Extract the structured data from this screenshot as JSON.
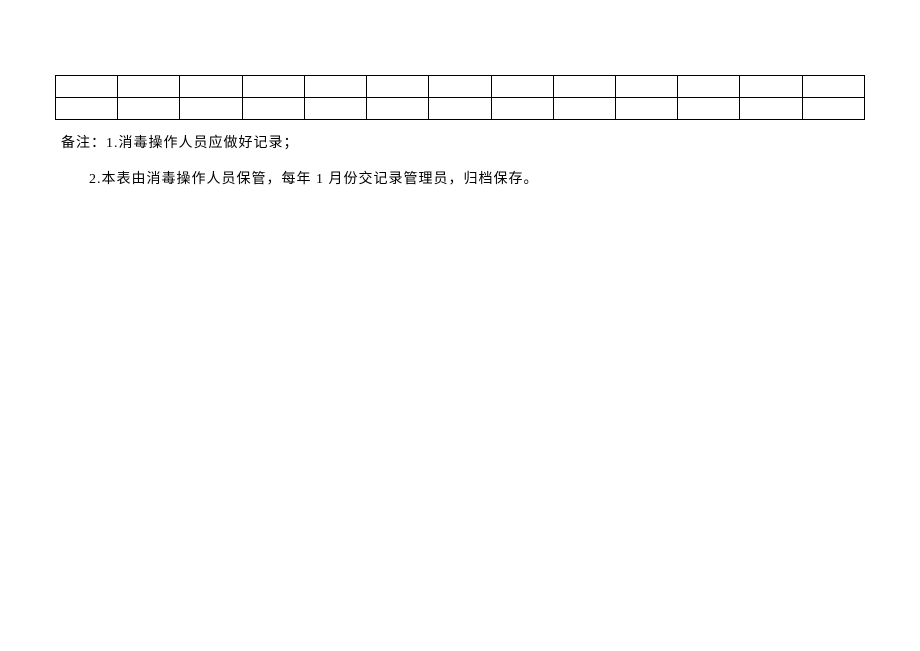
{
  "table": {
    "rows": 2,
    "cols": 13
  },
  "notes": {
    "line1": "备注：1.消毒操作人员应做好记录；",
    "line2": "2.本表由消毒操作人员保管，每年 1 月份交记录管理员，归档保存。"
  }
}
